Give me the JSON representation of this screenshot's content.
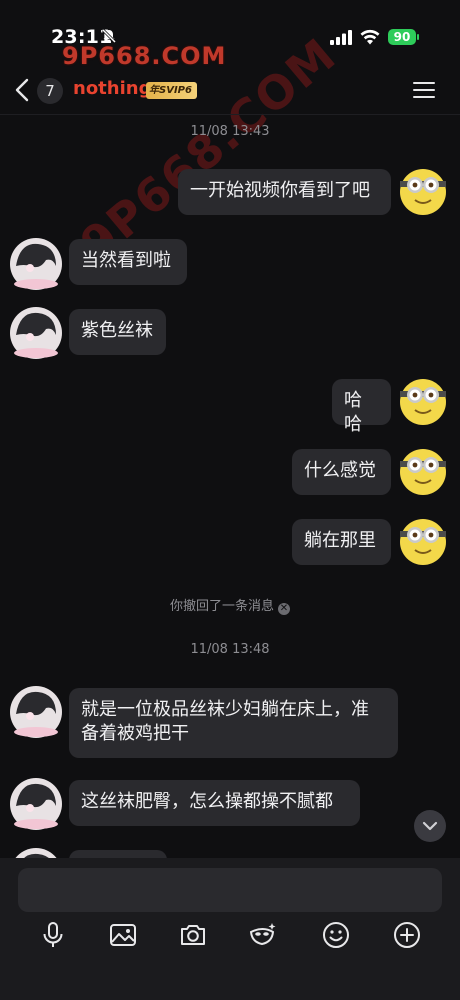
{
  "status": {
    "time": "23:11",
    "battery": "90"
  },
  "watermark": {
    "top": "9P668.COM",
    "diagonal": "9P668.COM"
  },
  "header": {
    "unread_count": "7",
    "name": "nothing",
    "vip": "年SVIP6"
  },
  "messages": [
    {
      "kind": "time",
      "text": "11/08 13:43"
    },
    {
      "kind": "out",
      "text": "一开始视频你看到了吧"
    },
    {
      "kind": "in",
      "text": "当然看到啦"
    },
    {
      "kind": "in",
      "text": "紫色丝袜"
    },
    {
      "kind": "out",
      "text": "哈哈"
    },
    {
      "kind": "out",
      "text": "什么感觉"
    },
    {
      "kind": "out",
      "text": "躺在那里"
    },
    {
      "kind": "recall",
      "text": "你撤回了一条消息"
    },
    {
      "kind": "time",
      "text": "11/08 13:48"
    },
    {
      "kind": "in",
      "text": "就是一位极品丝袜少妇躺在床上，准备着被鸡把干"
    },
    {
      "kind": "in",
      "text": "这丝袜肥臀，怎么操都操不腻都"
    }
  ],
  "toolbar": [
    "mic-icon",
    "image-icon",
    "camera-icon",
    "mask-icon",
    "emoji-icon",
    "plus-icon"
  ]
}
